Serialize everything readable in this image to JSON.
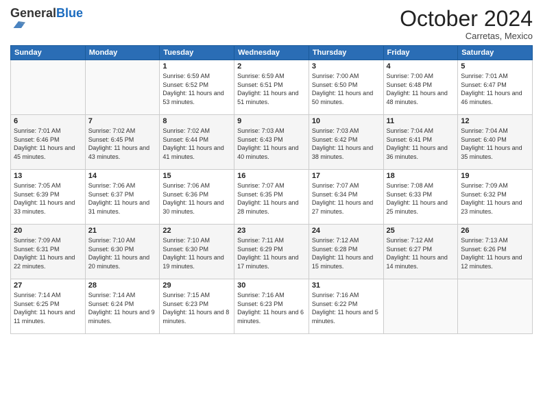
{
  "logo": {
    "general": "General",
    "blue": "Blue"
  },
  "header": {
    "month": "October 2024",
    "location": "Carretas, Mexico"
  },
  "weekdays": [
    "Sunday",
    "Monday",
    "Tuesday",
    "Wednesday",
    "Thursday",
    "Friday",
    "Saturday"
  ],
  "weeks": [
    [
      {
        "day": "",
        "sunrise": "",
        "sunset": "",
        "daylight": ""
      },
      {
        "day": "",
        "sunrise": "",
        "sunset": "",
        "daylight": ""
      },
      {
        "day": "1",
        "sunrise": "Sunrise: 6:59 AM",
        "sunset": "Sunset: 6:52 PM",
        "daylight": "Daylight: 11 hours and 53 minutes."
      },
      {
        "day": "2",
        "sunrise": "Sunrise: 6:59 AM",
        "sunset": "Sunset: 6:51 PM",
        "daylight": "Daylight: 11 hours and 51 minutes."
      },
      {
        "day": "3",
        "sunrise": "Sunrise: 7:00 AM",
        "sunset": "Sunset: 6:50 PM",
        "daylight": "Daylight: 11 hours and 50 minutes."
      },
      {
        "day": "4",
        "sunrise": "Sunrise: 7:00 AM",
        "sunset": "Sunset: 6:48 PM",
        "daylight": "Daylight: 11 hours and 48 minutes."
      },
      {
        "day": "5",
        "sunrise": "Sunrise: 7:01 AM",
        "sunset": "Sunset: 6:47 PM",
        "daylight": "Daylight: 11 hours and 46 minutes."
      }
    ],
    [
      {
        "day": "6",
        "sunrise": "Sunrise: 7:01 AM",
        "sunset": "Sunset: 6:46 PM",
        "daylight": "Daylight: 11 hours and 45 minutes."
      },
      {
        "day": "7",
        "sunrise": "Sunrise: 7:02 AM",
        "sunset": "Sunset: 6:45 PM",
        "daylight": "Daylight: 11 hours and 43 minutes."
      },
      {
        "day": "8",
        "sunrise": "Sunrise: 7:02 AM",
        "sunset": "Sunset: 6:44 PM",
        "daylight": "Daylight: 11 hours and 41 minutes."
      },
      {
        "day": "9",
        "sunrise": "Sunrise: 7:03 AM",
        "sunset": "Sunset: 6:43 PM",
        "daylight": "Daylight: 11 hours and 40 minutes."
      },
      {
        "day": "10",
        "sunrise": "Sunrise: 7:03 AM",
        "sunset": "Sunset: 6:42 PM",
        "daylight": "Daylight: 11 hours and 38 minutes."
      },
      {
        "day": "11",
        "sunrise": "Sunrise: 7:04 AM",
        "sunset": "Sunset: 6:41 PM",
        "daylight": "Daylight: 11 hours and 36 minutes."
      },
      {
        "day": "12",
        "sunrise": "Sunrise: 7:04 AM",
        "sunset": "Sunset: 6:40 PM",
        "daylight": "Daylight: 11 hours and 35 minutes."
      }
    ],
    [
      {
        "day": "13",
        "sunrise": "Sunrise: 7:05 AM",
        "sunset": "Sunset: 6:39 PM",
        "daylight": "Daylight: 11 hours and 33 minutes."
      },
      {
        "day": "14",
        "sunrise": "Sunrise: 7:06 AM",
        "sunset": "Sunset: 6:37 PM",
        "daylight": "Daylight: 11 hours and 31 minutes."
      },
      {
        "day": "15",
        "sunrise": "Sunrise: 7:06 AM",
        "sunset": "Sunset: 6:36 PM",
        "daylight": "Daylight: 11 hours and 30 minutes."
      },
      {
        "day": "16",
        "sunrise": "Sunrise: 7:07 AM",
        "sunset": "Sunset: 6:35 PM",
        "daylight": "Daylight: 11 hours and 28 minutes."
      },
      {
        "day": "17",
        "sunrise": "Sunrise: 7:07 AM",
        "sunset": "Sunset: 6:34 PM",
        "daylight": "Daylight: 11 hours and 27 minutes."
      },
      {
        "day": "18",
        "sunrise": "Sunrise: 7:08 AM",
        "sunset": "Sunset: 6:33 PM",
        "daylight": "Daylight: 11 hours and 25 minutes."
      },
      {
        "day": "19",
        "sunrise": "Sunrise: 7:09 AM",
        "sunset": "Sunset: 6:32 PM",
        "daylight": "Daylight: 11 hours and 23 minutes."
      }
    ],
    [
      {
        "day": "20",
        "sunrise": "Sunrise: 7:09 AM",
        "sunset": "Sunset: 6:31 PM",
        "daylight": "Daylight: 11 hours and 22 minutes."
      },
      {
        "day": "21",
        "sunrise": "Sunrise: 7:10 AM",
        "sunset": "Sunset: 6:30 PM",
        "daylight": "Daylight: 11 hours and 20 minutes."
      },
      {
        "day": "22",
        "sunrise": "Sunrise: 7:10 AM",
        "sunset": "Sunset: 6:30 PM",
        "daylight": "Daylight: 11 hours and 19 minutes."
      },
      {
        "day": "23",
        "sunrise": "Sunrise: 7:11 AM",
        "sunset": "Sunset: 6:29 PM",
        "daylight": "Daylight: 11 hours and 17 minutes."
      },
      {
        "day": "24",
        "sunrise": "Sunrise: 7:12 AM",
        "sunset": "Sunset: 6:28 PM",
        "daylight": "Daylight: 11 hours and 15 minutes."
      },
      {
        "day": "25",
        "sunrise": "Sunrise: 7:12 AM",
        "sunset": "Sunset: 6:27 PM",
        "daylight": "Daylight: 11 hours and 14 minutes."
      },
      {
        "day": "26",
        "sunrise": "Sunrise: 7:13 AM",
        "sunset": "Sunset: 6:26 PM",
        "daylight": "Daylight: 11 hours and 12 minutes."
      }
    ],
    [
      {
        "day": "27",
        "sunrise": "Sunrise: 7:14 AM",
        "sunset": "Sunset: 6:25 PM",
        "daylight": "Daylight: 11 hours and 11 minutes."
      },
      {
        "day": "28",
        "sunrise": "Sunrise: 7:14 AM",
        "sunset": "Sunset: 6:24 PM",
        "daylight": "Daylight: 11 hours and 9 minutes."
      },
      {
        "day": "29",
        "sunrise": "Sunrise: 7:15 AM",
        "sunset": "Sunset: 6:23 PM",
        "daylight": "Daylight: 11 hours and 8 minutes."
      },
      {
        "day": "30",
        "sunrise": "Sunrise: 7:16 AM",
        "sunset": "Sunset: 6:23 PM",
        "daylight": "Daylight: 11 hours and 6 minutes."
      },
      {
        "day": "31",
        "sunrise": "Sunrise: 7:16 AM",
        "sunset": "Sunset: 6:22 PM",
        "daylight": "Daylight: 11 hours and 5 minutes."
      },
      {
        "day": "",
        "sunrise": "",
        "sunset": "",
        "daylight": ""
      },
      {
        "day": "",
        "sunrise": "",
        "sunset": "",
        "daylight": ""
      }
    ]
  ]
}
